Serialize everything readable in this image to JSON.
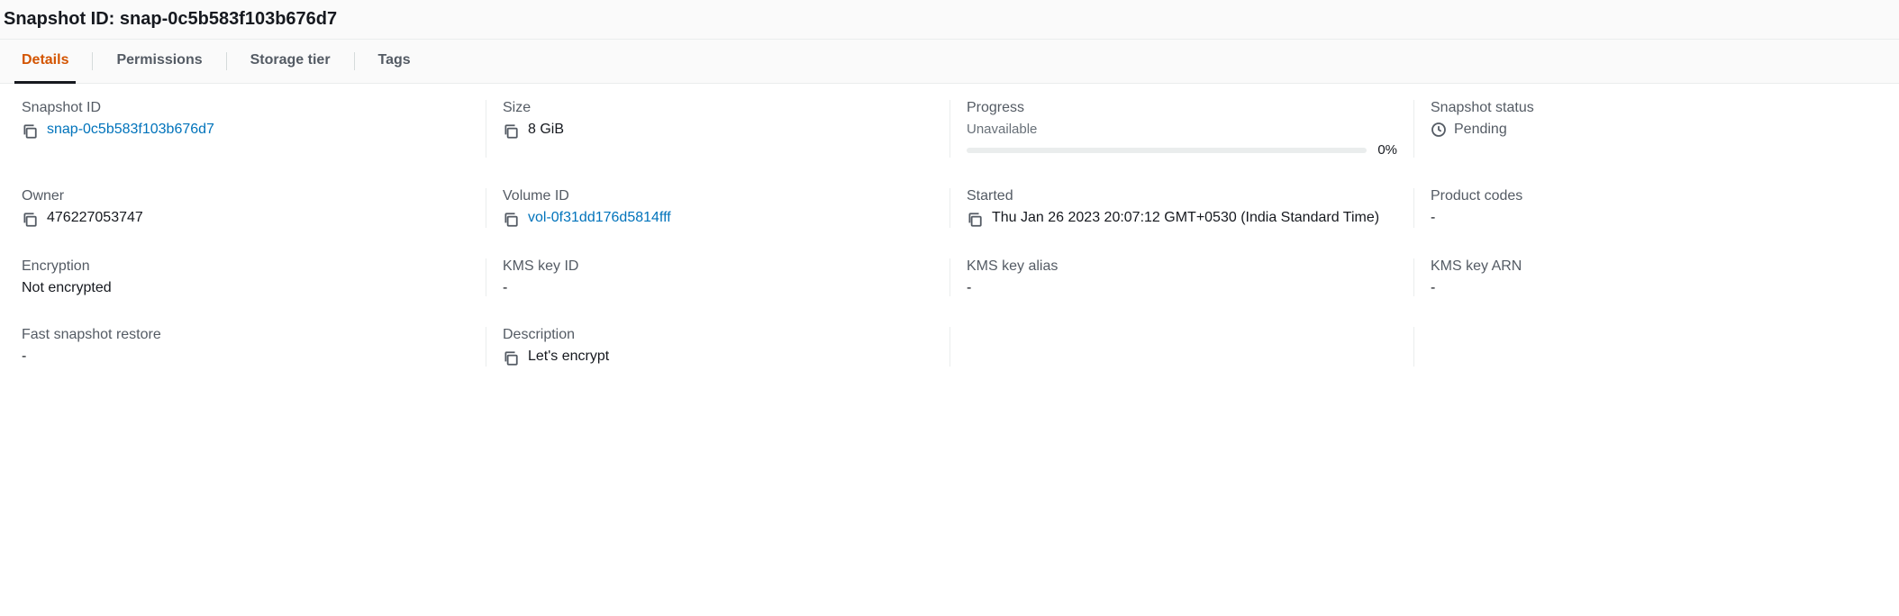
{
  "header": {
    "title_prefix": "Snapshot ID: ",
    "title_value": "snap-0c5b583f103b676d7"
  },
  "tabs": {
    "details": "Details",
    "permissions": "Permissions",
    "storage_tier": "Storage tier",
    "tags": "Tags"
  },
  "details": {
    "snapshot_id": {
      "label": "Snapshot ID",
      "value": "snap-0c5b583f103b676d7"
    },
    "size": {
      "label": "Size",
      "value": "8 GiB"
    },
    "progress": {
      "label": "Progress",
      "status_text": "Unavailable",
      "percent": "0%"
    },
    "snapshot_status": {
      "label": "Snapshot status",
      "value": "Pending"
    },
    "owner": {
      "label": "Owner",
      "value": "476227053747"
    },
    "volume_id": {
      "label": "Volume ID",
      "value": "vol-0f31dd176d5814fff"
    },
    "started": {
      "label": "Started",
      "value": "Thu Jan 26 2023 20:07:12 GMT+0530 (India Standard Time)"
    },
    "product_codes": {
      "label": "Product codes",
      "value": "-"
    },
    "encryption": {
      "label": "Encryption",
      "value": "Not encrypted"
    },
    "kms_key_id": {
      "label": "KMS key ID",
      "value": "-"
    },
    "kms_key_alias": {
      "label": "KMS key alias",
      "value": "-"
    },
    "kms_key_arn": {
      "label": "KMS key ARN",
      "value": "-"
    },
    "fast_snapshot_restore": {
      "label": "Fast snapshot restore",
      "value": "-"
    },
    "description": {
      "label": "Description",
      "value": "Let's encrypt"
    }
  }
}
